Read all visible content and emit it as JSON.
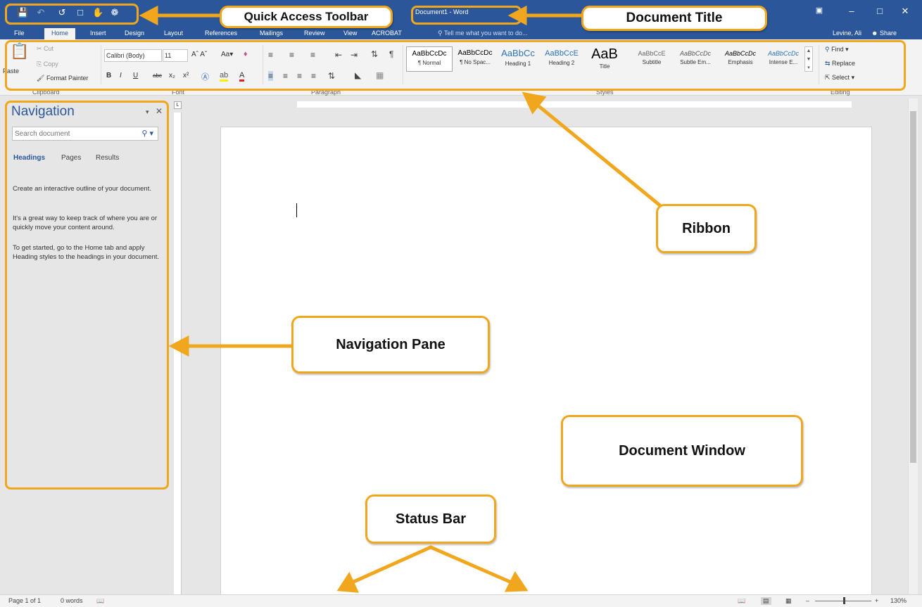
{
  "window": {
    "doc_title": "Document1 - Word",
    "user": "Levine, Ali",
    "share": "Share"
  },
  "menu_tabs": [
    "File",
    "Home",
    "Insert",
    "Design",
    "Layout",
    "References",
    "Mailings",
    "Review",
    "View",
    "ACROBAT"
  ],
  "tell_me": "Tell me what you want to do...",
  "ribbon": {
    "clipboard": {
      "paste": "Paste",
      "cut": "Cut",
      "copy": "Copy",
      "format_painter": "Format Painter",
      "label": "Clipboard"
    },
    "font": {
      "family": "Calibri (Body)",
      "size": "11",
      "label": "Font"
    },
    "paragraph": {
      "label": "Paragraph"
    },
    "styles": {
      "label": "Styles",
      "items": [
        {
          "sample": "AaBbCcDc",
          "name": "¶ Normal"
        },
        {
          "sample": "AaBbCcDc",
          "name": "¶ No Spac..."
        },
        {
          "sample": "AaBbCc",
          "name": "Heading 1"
        },
        {
          "sample": "AaBbCcE",
          "name": "Heading 2"
        },
        {
          "sample": "AaB",
          "name": "Title"
        },
        {
          "sample": "AaBbCcE",
          "name": "Subtitle"
        },
        {
          "sample": "AaBbCcDc",
          "name": "Subtle Em..."
        },
        {
          "sample": "AaBbCcDc",
          "name": "Emphasis"
        },
        {
          "sample": "AaBbCcDc",
          "name": "Intense E..."
        }
      ]
    },
    "editing": {
      "find": "Find",
      "replace": "Replace",
      "select": "Select",
      "label": "Editing"
    }
  },
  "navigation": {
    "title": "Navigation",
    "search_placeholder": "Search document",
    "tabs": [
      "Headings",
      "Pages",
      "Results"
    ],
    "texts": [
      "Create an interactive outline of your document.",
      "It's a great way to keep track of where you are or quickly move your content around.",
      "To get started, go to the Home tab and apply Heading styles to the headings in your document."
    ]
  },
  "status": {
    "page": "Page 1 of 1",
    "words": "0 words",
    "zoom": "130%"
  },
  "callouts": {
    "qat": "Quick Access Toolbar",
    "title": "Document Title",
    "ribbon": "Ribbon",
    "nav": "Navigation Pane",
    "doc": "Document Window",
    "status": "Status Bar"
  },
  "colors": {
    "accent": "#2b579a",
    "callout": "#f1a71d"
  }
}
